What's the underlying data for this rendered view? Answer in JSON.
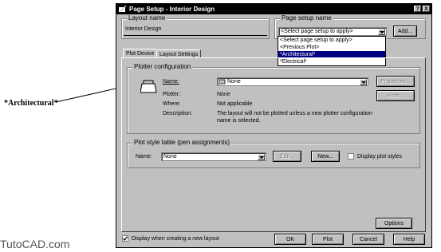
{
  "callout": "*Architectural*",
  "watermark": "TutoCAD.com",
  "dialog": {
    "title": "Page Setup - Interior Design",
    "help_btn": "?",
    "close_btn": "X",
    "layout_name": {
      "label": "Layout name",
      "value": "Interior Design"
    },
    "page_setup": {
      "label": "Page setup name",
      "selected": "<Select page setup to apply>",
      "add_button": "Add...",
      "options": [
        "<Select page setup to apply>",
        "<Previous Plot>",
        "*Architectural*",
        "*Electrical*"
      ],
      "highlighted": "*Architectural*"
    },
    "tabs": [
      "Plot Device",
      "Layout Settings"
    ],
    "plotter_config": {
      "label": "Plotter configuration",
      "name_label": "Name:",
      "name_value": "None",
      "properties_button": "Properties...",
      "hints_button": "Hints...",
      "plotter_label": "Plotter:",
      "plotter_value": "None",
      "where_label": "Where:",
      "where_value": "Not applicable",
      "description_label": "Description:",
      "description_line1": "The layout will not be plotted unless a new plotter configuration",
      "description_line2": "name is selected."
    },
    "plot_style": {
      "label": "Plot style table (pen assignments)",
      "name_label": "Name:",
      "name_value": "None",
      "edit_button": "Edit...",
      "new_button": "New...",
      "display_label": "Display plot styles"
    },
    "options_button": "Options",
    "display_new_layout_label": "Display when creating a new layout",
    "ok_button": "OK",
    "plot_button": "Plot",
    "cancel_button": "Cancel",
    "help_button": "Help"
  }
}
